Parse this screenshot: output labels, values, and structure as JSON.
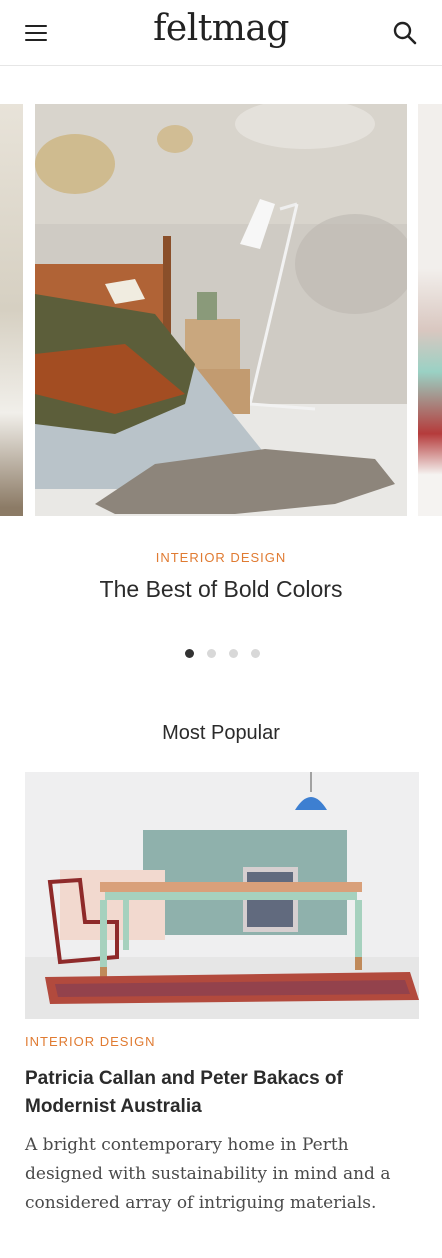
{
  "header": {
    "logo": "feltmag",
    "menu_icon": "hamburger-menu-icon",
    "search_icon": "search-icon"
  },
  "carousel": {
    "active_index": 0,
    "slide_count": 4,
    "active_slide": {
      "category": "INTERIOR DESIGN",
      "title": "The Best of Bold Colors"
    }
  },
  "most_popular": {
    "heading": "Most Popular",
    "article": {
      "category": "INTERIOR DESIGN",
      "title": "Patricia Callan and Peter Bakacs of Modernist Australia",
      "excerpt": "A bright contemporary home in Perth designed with sustainability in mind and a considered array of intriguing materials."
    }
  },
  "colors": {
    "accent": "#e07b32",
    "text": "#2b2b2b",
    "dot_active": "#333333",
    "dot_inactive": "#d8d8d8"
  }
}
